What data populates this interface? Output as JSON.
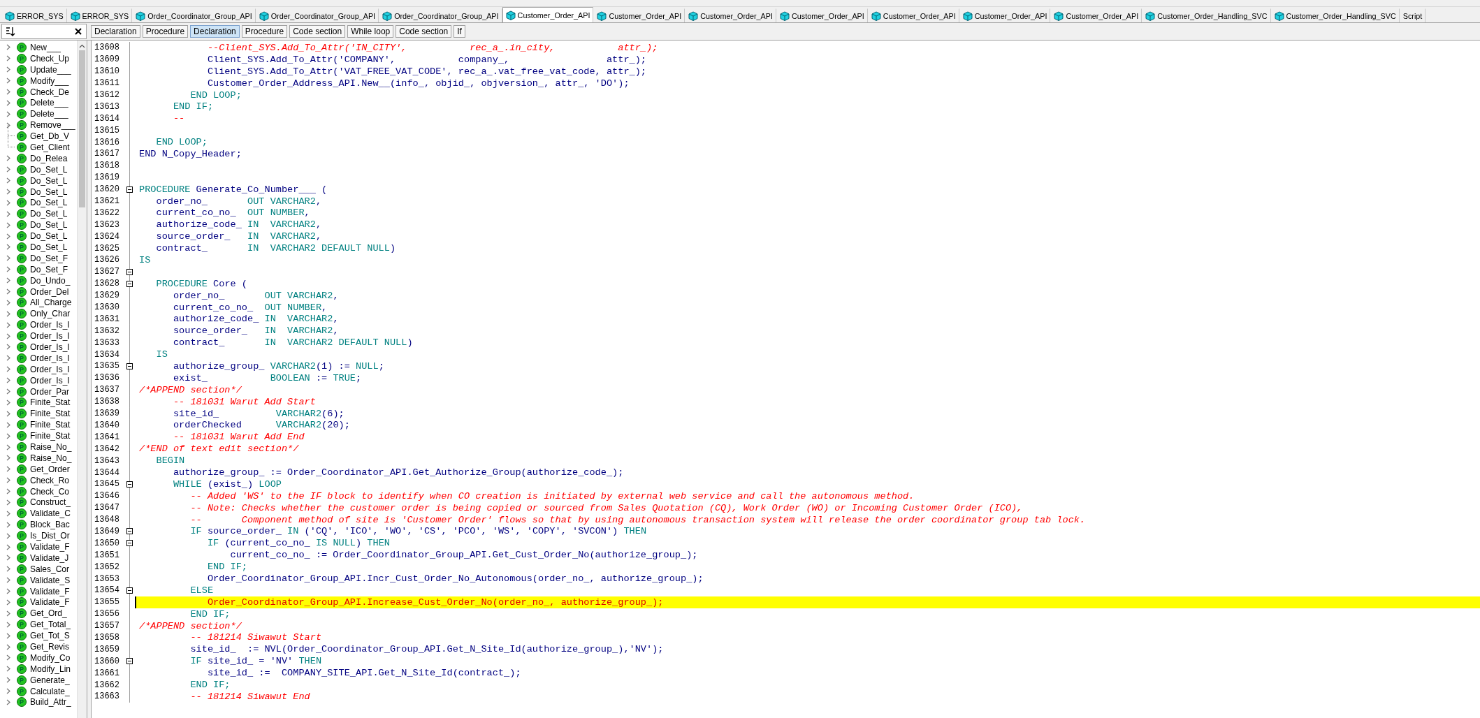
{
  "tabs": [
    {
      "label": "ERROR_SYS",
      "kind": "object",
      "selected": false
    },
    {
      "label": "ERROR_SYS",
      "kind": "object",
      "selected": false
    },
    {
      "label": "Order_Coordinator_Group_API",
      "kind": "object",
      "selected": false
    },
    {
      "label": "Order_Coordinator_Group_API",
      "kind": "object",
      "selected": false
    },
    {
      "label": "Order_Coordinator_Group_API",
      "kind": "object",
      "selected": false
    },
    {
      "label": "Customer_Order_API",
      "kind": "object",
      "selected": true
    },
    {
      "label": "Customer_Order_API",
      "kind": "object",
      "selected": false
    },
    {
      "label": "Customer_Order_API",
      "kind": "object",
      "selected": false
    },
    {
      "label": "Customer_Order_API",
      "kind": "object",
      "selected": false
    },
    {
      "label": "Customer_Order_API",
      "kind": "object",
      "selected": false
    },
    {
      "label": "Customer_Order_API",
      "kind": "object",
      "selected": false
    },
    {
      "label": "Customer_Order_API",
      "kind": "object",
      "selected": false
    },
    {
      "label": "Customer_Order_Handling_SVC",
      "kind": "object",
      "selected": false
    },
    {
      "label": "Customer_Order_Handling_SVC",
      "kind": "object",
      "selected": false
    },
    {
      "label": "Script",
      "kind": "script",
      "selected": false
    }
  ],
  "breadcrumb": [
    {
      "label": "Declaration",
      "selected": false
    },
    {
      "label": "Procedure",
      "selected": false
    },
    {
      "label": "Declaration",
      "selected": true
    },
    {
      "label": "Procedure",
      "selected": false
    },
    {
      "label": "Code section",
      "selected": false
    },
    {
      "label": "While loop",
      "selected": false
    },
    {
      "label": "Code section",
      "selected": false
    },
    {
      "label": "If",
      "selected": false
    }
  ],
  "sidebar": {
    "items": [
      {
        "label": "New___",
        "badge": "P",
        "expandable": true
      },
      {
        "label": "Check_Up",
        "badge": "P",
        "expandable": true
      },
      {
        "label": "Update___",
        "badge": "P",
        "expandable": true
      },
      {
        "label": "Modify___",
        "badge": "P",
        "expandable": true
      },
      {
        "label": "Check_De",
        "badge": "P",
        "expandable": true
      },
      {
        "label": "Delete___",
        "badge": "P",
        "expandable": true
      },
      {
        "label": "Delete___",
        "badge": "P",
        "expandable": true
      },
      {
        "label": "Remove___",
        "badge": "P",
        "expandable": true
      },
      {
        "label": "Get_Db_V",
        "badge": "P",
        "expandable": false
      },
      {
        "label": "Get_Client",
        "badge": "P",
        "expandable": false
      },
      {
        "label": "Do_Relea",
        "badge": "P",
        "expandable": true
      },
      {
        "label": "Do_Set_L",
        "badge": "P",
        "expandable": true
      },
      {
        "label": "Do_Set_L",
        "badge": "P",
        "expandable": true
      },
      {
        "label": "Do_Set_L",
        "badge": "P",
        "expandable": true
      },
      {
        "label": "Do_Set_L",
        "badge": "P",
        "expandable": true
      },
      {
        "label": "Do_Set_L",
        "badge": "P",
        "expandable": true
      },
      {
        "label": "Do_Set_L",
        "badge": "P",
        "expandable": true
      },
      {
        "label": "Do_Set_L",
        "badge": "P",
        "expandable": true
      },
      {
        "label": "Do_Set_L",
        "badge": "P",
        "expandable": true
      },
      {
        "label": "Do_Set_F",
        "badge": "P",
        "expandable": true
      },
      {
        "label": "Do_Set_F",
        "badge": "P",
        "expandable": true
      },
      {
        "label": "Do_Undo_",
        "badge": "P",
        "expandable": true
      },
      {
        "label": "Order_Del",
        "badge": "P",
        "expandable": true
      },
      {
        "label": "All_Charge",
        "badge": "P",
        "expandable": true
      },
      {
        "label": "Only_Char",
        "badge": "P",
        "expandable": true
      },
      {
        "label": "Order_Is_I",
        "badge": "P",
        "expandable": true
      },
      {
        "label": "Order_Is_I",
        "badge": "P",
        "expandable": true
      },
      {
        "label": "Order_Is_I",
        "badge": "P",
        "expandable": true
      },
      {
        "label": "Order_Is_I",
        "badge": "P",
        "expandable": true
      },
      {
        "label": "Order_Is_I",
        "badge": "P",
        "expandable": true
      },
      {
        "label": "Order_Is_I",
        "badge": "P",
        "expandable": true
      },
      {
        "label": "Order_Par",
        "badge": "P",
        "expandable": true
      },
      {
        "label": "Finite_Stat",
        "badge": "P",
        "expandable": true
      },
      {
        "label": "Finite_Stat",
        "badge": "P",
        "expandable": true
      },
      {
        "label": "Finite_Stat",
        "badge": "P",
        "expandable": true
      },
      {
        "label": "Finite_Stat",
        "badge": "P",
        "expandable": true
      },
      {
        "label": "Raise_No_",
        "badge": "P",
        "expandable": true
      },
      {
        "label": "Raise_No_",
        "badge": "P",
        "expandable": true
      },
      {
        "label": "Get_Order",
        "badge": "P",
        "expandable": true
      },
      {
        "label": "Check_Ro",
        "badge": "P",
        "expandable": true
      },
      {
        "label": "Check_Co",
        "badge": "P",
        "expandable": true
      },
      {
        "label": "Construct_",
        "badge": "P",
        "expandable": true
      },
      {
        "label": "Validate_C",
        "badge": "P",
        "expandable": true
      },
      {
        "label": "Block_Bac",
        "badge": "P",
        "expandable": true
      },
      {
        "label": "Is_Dist_Or",
        "badge": "P",
        "expandable": true
      },
      {
        "label": "Validate_F",
        "badge": "P",
        "expandable": true
      },
      {
        "label": "Validate_J",
        "badge": "P",
        "expandable": true
      },
      {
        "label": "Sales_Cor",
        "badge": "P",
        "expandable": true
      },
      {
        "label": "Validate_S",
        "badge": "P",
        "expandable": true
      },
      {
        "label": "Validate_F",
        "badge": "P",
        "expandable": true
      },
      {
        "label": "Validate_F",
        "badge": "P",
        "expandable": true
      },
      {
        "label": "Get_Ord_",
        "badge": "P",
        "expandable": true
      },
      {
        "label": "Get_Total_",
        "badge": "P",
        "expandable": true
      },
      {
        "label": "Get_Tot_S",
        "badge": "P",
        "expandable": true
      },
      {
        "label": "Get_Revis",
        "badge": "P",
        "expandable": true
      },
      {
        "label": "Modify_Co",
        "badge": "P",
        "expandable": true
      },
      {
        "label": "Modify_Lin",
        "badge": "P",
        "expandable": true
      },
      {
        "label": "Generate_",
        "badge": "P",
        "expandable": true
      },
      {
        "label": "Calculate_",
        "badge": "P",
        "expandable": true
      },
      {
        "label": "Build_Attr_",
        "badge": "P",
        "expandable": true
      }
    ]
  },
  "editor": {
    "lines": [
      {
        "number": "13608",
        "fold": false,
        "highlighted": false,
        "segments": [
          {
            "kind": "comment",
            "text": "            --Client_SYS.Add_To_Attr('IN_CITY',           rec_a_.in_city,           attr_);"
          }
        ]
      },
      {
        "number": "13609",
        "fold": false,
        "highlighted": false,
        "segments": [
          {
            "kind": "code",
            "text": "            Client_SYS.Add_To_Attr('COMPANY',           company_,                 attr_);"
          }
        ]
      },
      {
        "number": "13610",
        "fold": false,
        "highlighted": false,
        "segments": [
          {
            "kind": "code",
            "text": "            Client_SYS.Add_To_Attr('VAT_FREE_VAT_CODE', rec_a_.vat_free_vat_code, attr_);"
          }
        ]
      },
      {
        "number": "13611",
        "fold": false,
        "highlighted": false,
        "segments": [
          {
            "kind": "code",
            "text": "            Customer_Order_Address_API.New__(info_, objid_, objversion_, attr_, 'DO');"
          }
        ]
      },
      {
        "number": "13612",
        "fold": false,
        "highlighted": false,
        "segments": [
          {
            "kind": "keyword",
            "text": "         END LOOP;"
          }
        ]
      },
      {
        "number": "13613",
        "fold": false,
        "highlighted": false,
        "segments": [
          {
            "kind": "keyword",
            "text": "      END IF;"
          }
        ]
      },
      {
        "number": "13614",
        "fold": false,
        "highlighted": false,
        "segments": [
          {
            "kind": "comment",
            "text": "      --"
          }
        ]
      },
      {
        "number": "13615",
        "fold": false,
        "highlighted": false
      },
      {
        "number": "13616",
        "fold": false,
        "highlighted": false,
        "segments": [
          {
            "kind": "keyword",
            "text": "   END LOOP;"
          }
        ]
      },
      {
        "number": "13617",
        "fold": false,
        "highlighted": false,
        "segments": [
          {
            "kind": "code",
            "text": "END N_Copy_Header;"
          }
        ]
      },
      {
        "number": "13618",
        "fold": false,
        "highlighted": false
      },
      {
        "number": "13619",
        "fold": false,
        "highlighted": false
      },
      {
        "number": "13620",
        "fold": true,
        "highlighted": false,
        "segments": [
          {
            "kind": "keyword",
            "text": "PROCEDURE"
          },
          {
            "kind": "code",
            "text": " Generate_Co_Number___ ("
          }
        ]
      },
      {
        "number": "13621",
        "fold": false,
        "highlighted": false,
        "segments": [
          {
            "kind": "code",
            "text": "   order_no_       "
          },
          {
            "kind": "keyword",
            "text": "OUT VARCHAR2"
          },
          {
            "kind": "code",
            "text": ","
          }
        ]
      },
      {
        "number": "13622",
        "fold": false,
        "highlighted": false,
        "segments": [
          {
            "kind": "code",
            "text": "   current_co_no_  "
          },
          {
            "kind": "keyword",
            "text": "OUT NUMBER"
          },
          {
            "kind": "code",
            "text": ","
          }
        ]
      },
      {
        "number": "13623",
        "fold": false,
        "highlighted": false,
        "segments": [
          {
            "kind": "code",
            "text": "   authorize_code_ "
          },
          {
            "kind": "keyword",
            "text": "IN  VARCHAR2"
          },
          {
            "kind": "code",
            "text": ","
          }
        ]
      },
      {
        "number": "13624",
        "fold": false,
        "highlighted": false,
        "segments": [
          {
            "kind": "code",
            "text": "   source_order_   "
          },
          {
            "kind": "keyword",
            "text": "IN  VARCHAR2"
          },
          {
            "kind": "code",
            "text": ","
          }
        ]
      },
      {
        "number": "13625",
        "fold": false,
        "highlighted": false,
        "segments": [
          {
            "kind": "code",
            "text": "   contract_       "
          },
          {
            "kind": "keyword",
            "text": "IN  VARCHAR2 DEFAULT NULL"
          },
          {
            "kind": "code",
            "text": ")"
          }
        ]
      },
      {
        "number": "13626",
        "fold": false,
        "highlighted": false,
        "segments": [
          {
            "kind": "keyword",
            "text": "IS"
          }
        ]
      },
      {
        "number": "13627",
        "fold": true,
        "highlighted": false
      },
      {
        "number": "13628",
        "fold": true,
        "highlighted": false,
        "segments": [
          {
            "kind": "keyword",
            "text": "   PROCEDURE"
          },
          {
            "kind": "code",
            "text": " Core ("
          }
        ]
      },
      {
        "number": "13629",
        "fold": false,
        "highlighted": false,
        "segments": [
          {
            "kind": "code",
            "text": "      order_no_       "
          },
          {
            "kind": "keyword",
            "text": "OUT VARCHAR2"
          },
          {
            "kind": "code",
            "text": ","
          }
        ]
      },
      {
        "number": "13630",
        "fold": false,
        "highlighted": false,
        "segments": [
          {
            "kind": "code",
            "text": "      current_co_no_  "
          },
          {
            "kind": "keyword",
            "text": "OUT NUMBER"
          },
          {
            "kind": "code",
            "text": ","
          }
        ]
      },
      {
        "number": "13631",
        "fold": false,
        "highlighted": false,
        "segments": [
          {
            "kind": "code",
            "text": "      authorize_code_ "
          },
          {
            "kind": "keyword",
            "text": "IN  VARCHAR2"
          },
          {
            "kind": "code",
            "text": ","
          }
        ]
      },
      {
        "number": "13632",
        "fold": false,
        "highlighted": false,
        "segments": [
          {
            "kind": "code",
            "text": "      source_order_   "
          },
          {
            "kind": "keyword",
            "text": "IN  VARCHAR2"
          },
          {
            "kind": "code",
            "text": ","
          }
        ]
      },
      {
        "number": "13633",
        "fold": false,
        "highlighted": false,
        "segments": [
          {
            "kind": "code",
            "text": "      contract_       "
          },
          {
            "kind": "keyword",
            "text": "IN  VARCHAR2 DEFAULT NULL"
          },
          {
            "kind": "code",
            "text": ")"
          }
        ]
      },
      {
        "number": "13634",
        "fold": false,
        "highlighted": false,
        "segments": [
          {
            "kind": "keyword",
            "text": "   IS"
          }
        ]
      },
      {
        "number": "13635",
        "fold": true,
        "highlighted": false,
        "segments": [
          {
            "kind": "code",
            "text": "      authorize_group_ "
          },
          {
            "kind": "keyword",
            "text": "VARCHAR2"
          },
          {
            "kind": "code",
            "text": "(1) := "
          },
          {
            "kind": "keyword",
            "text": "NULL"
          },
          {
            "kind": "code",
            "text": ";"
          }
        ]
      },
      {
        "number": "13636",
        "fold": false,
        "highlighted": false,
        "segments": [
          {
            "kind": "code",
            "text": "      exist_           "
          },
          {
            "kind": "keyword",
            "text": "BOOLEAN"
          },
          {
            "kind": "code",
            "text": " := "
          },
          {
            "kind": "keyword",
            "text": "TRUE"
          },
          {
            "kind": "code",
            "text": ";"
          }
        ]
      },
      {
        "number": "13637",
        "fold": false,
        "highlighted": false,
        "segments": [
          {
            "kind": "comment",
            "text": "/*APPEND section*/"
          }
        ]
      },
      {
        "number": "13638",
        "fold": false,
        "highlighted": false,
        "segments": [
          {
            "kind": "comment",
            "text": "      -- 181031 Warut Add Start"
          }
        ]
      },
      {
        "number": "13639",
        "fold": false,
        "highlighted": false,
        "segments": [
          {
            "kind": "code",
            "text": "      site_id_          "
          },
          {
            "kind": "keyword",
            "text": "VARCHAR2"
          },
          {
            "kind": "code",
            "text": "(6);"
          }
        ]
      },
      {
        "number": "13640",
        "fold": false,
        "highlighted": false,
        "segments": [
          {
            "kind": "code",
            "text": "      orderChecked      "
          },
          {
            "kind": "keyword",
            "text": "VARCHAR2"
          },
          {
            "kind": "code",
            "text": "(20);"
          }
        ]
      },
      {
        "number": "13641",
        "fold": false,
        "highlighted": false,
        "segments": [
          {
            "kind": "comment",
            "text": "      -- 181031 Warut Add End"
          }
        ]
      },
      {
        "number": "13642",
        "fold": false,
        "highlighted": false,
        "segments": [
          {
            "kind": "comment",
            "text": "/*END of text edit section*/"
          }
        ]
      },
      {
        "number": "13643",
        "fold": false,
        "highlighted": false,
        "segments": [
          {
            "kind": "keyword",
            "text": "   BEGIN"
          }
        ]
      },
      {
        "number": "13644",
        "fold": false,
        "highlighted": false,
        "segments": [
          {
            "kind": "code",
            "text": "      authorize_group_ := Order_Coordinator_API.Get_Authorize_Group(authorize_code_);"
          }
        ]
      },
      {
        "number": "13645",
        "fold": true,
        "highlighted": false,
        "segments": [
          {
            "kind": "keyword",
            "text": "      WHILE"
          },
          {
            "kind": "code",
            "text": " (exist_) "
          },
          {
            "kind": "keyword",
            "text": "LOOP"
          }
        ]
      },
      {
        "number": "13646",
        "fold": false,
        "highlighted": false,
        "segments": [
          {
            "kind": "comment",
            "text": "         -- Added 'WS' to the IF block to identify when CO creation is initiated by external web service and call the autonomous method."
          }
        ]
      },
      {
        "number": "13647",
        "fold": false,
        "highlighted": false,
        "segments": [
          {
            "kind": "comment",
            "text": "         -- Note: Checks whether the customer order is being copied or sourced from Sales Quotation (CQ), Work Order (WO) or Incoming Customer Order (ICO),"
          }
        ]
      },
      {
        "number": "13648",
        "fold": false,
        "highlighted": false,
        "segments": [
          {
            "kind": "comment",
            "text": "         --       Component method of site is 'Customer Order' flows so that by using autonomous transaction system will release the order coordinator group tab lock."
          }
        ]
      },
      {
        "number": "13649",
        "fold": true,
        "highlighted": false,
        "segments": [
          {
            "kind": "keyword",
            "text": "         IF"
          },
          {
            "kind": "code",
            "text": " source_order_ "
          },
          {
            "kind": "keyword",
            "text": "IN"
          },
          {
            "kind": "code",
            "text": " ('CQ', 'ICO', 'WO', 'CS', 'PCO', 'WS', 'COPY', 'SVCON') "
          },
          {
            "kind": "keyword",
            "text": "THEN"
          }
        ]
      },
      {
        "number": "13650",
        "fold": true,
        "highlighted": false,
        "segments": [
          {
            "kind": "keyword",
            "text": "            IF"
          },
          {
            "kind": "code",
            "text": " (current_co_no_ "
          },
          {
            "kind": "keyword",
            "text": "IS NULL"
          },
          {
            "kind": "code",
            "text": ") "
          },
          {
            "kind": "keyword",
            "text": "THEN"
          }
        ]
      },
      {
        "number": "13651",
        "fold": false,
        "highlighted": false,
        "segments": [
          {
            "kind": "code",
            "text": "                current_co_no_ := Order_Coordinator_Group_API.Get_Cust_Order_No(authorize_group_);"
          }
        ]
      },
      {
        "number": "13652",
        "fold": false,
        "highlighted": false,
        "segments": [
          {
            "kind": "keyword",
            "text": "            END IF;"
          }
        ]
      },
      {
        "number": "13653",
        "fold": false,
        "highlighted": false,
        "segments": [
          {
            "kind": "code",
            "text": "            Order_Coordinator_Group_API.Incr_Cust_Order_No_Autonomous(order_no_, authorize_group_);"
          }
        ]
      },
      {
        "number": "13654",
        "fold": true,
        "highlighted": false,
        "segments": [
          {
            "kind": "keyword",
            "text": "         ELSE"
          }
        ]
      },
      {
        "number": "13655",
        "fold": false,
        "highlighted": true,
        "segments": [
          {
            "kind": "code",
            "text": "            Order_Coordinator_Group_API.Increase_Cust_Order_No(order_no_, authorize_group_);"
          }
        ]
      },
      {
        "number": "13656",
        "fold": false,
        "highlighted": false,
        "segments": [
          {
            "kind": "keyword",
            "text": "         END IF;"
          }
        ]
      },
      {
        "number": "13657",
        "fold": false,
        "highlighted": false,
        "segments": [
          {
            "kind": "comment",
            "text": "/*APPEND section*/"
          }
        ]
      },
      {
        "number": "13658",
        "fold": false,
        "highlighted": false,
        "segments": [
          {
            "kind": "comment",
            "text": "         -- 181214 Siwawut Start"
          }
        ]
      },
      {
        "number": "13659",
        "fold": false,
        "highlighted": false,
        "segments": [
          {
            "kind": "code",
            "text": "         site_id_  := NVL(Order_Coordinator_Group_API.Get_N_Site_Id(authorize_group_),'NV');"
          }
        ]
      },
      {
        "number": "13660",
        "fold": true,
        "highlighted": false,
        "segments": [
          {
            "kind": "keyword",
            "text": "         IF"
          },
          {
            "kind": "code",
            "text": " site_id_ = 'NV' "
          },
          {
            "kind": "keyword",
            "text": "THEN"
          }
        ]
      },
      {
        "number": "13661",
        "fold": false,
        "highlighted": false,
        "segments": [
          {
            "kind": "code",
            "text": "            site_id_ :=  COMPANY_SITE_API.Get_N_Site_Id(contract_);"
          }
        ]
      },
      {
        "number": "13662",
        "fold": false,
        "highlighted": false,
        "segments": [
          {
            "kind": "keyword",
            "text": "         END IF;"
          }
        ]
      },
      {
        "number": "13663",
        "fold": false,
        "highlighted": false,
        "segments": [
          {
            "kind": "comment",
            "text": "         -- 181214 Siwawut End"
          }
        ]
      }
    ]
  }
}
